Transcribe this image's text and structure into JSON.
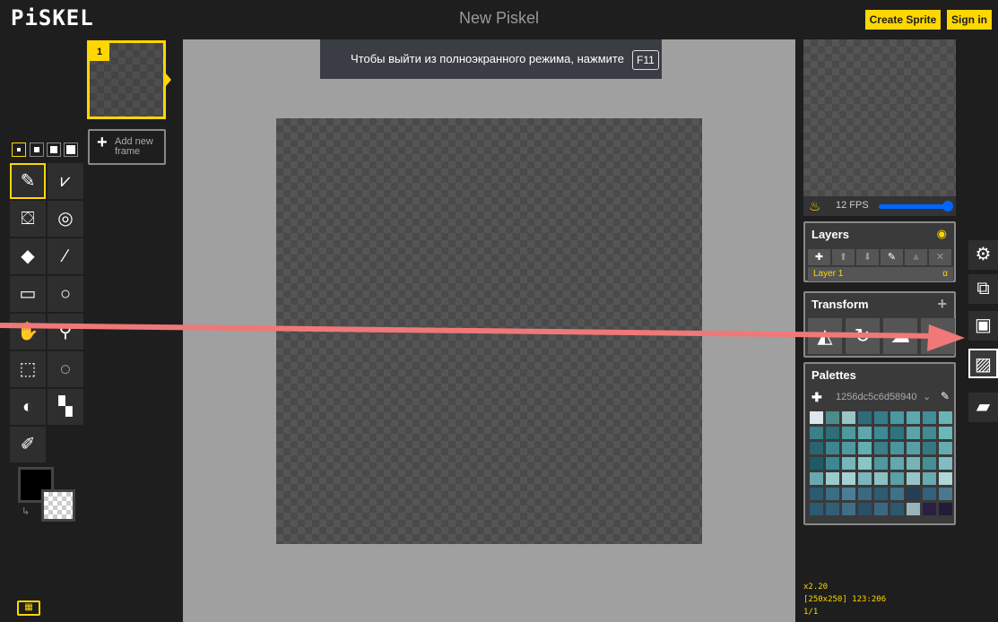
{
  "app": {
    "logo": "PiSKEL",
    "title": "New Piskel"
  },
  "header": {
    "create_sprite": "Create Sprite",
    "sign_in": "Sign in"
  },
  "frames": {
    "first_number": "1",
    "add_frame": "Add new frame"
  },
  "tools": {
    "items": [
      "pen-tool",
      "vertical-mirror-pen-tool",
      "paint-bucket-tool",
      "paint-same-color-tool",
      "eraser-tool",
      "stroke-tool",
      "rectangle-tool",
      "circle-tool",
      "move-tool",
      "shape-selection-tool",
      "rectangle-selection-tool",
      "lasso-selection-tool",
      "lighten-tool",
      "dithering-tool",
      "color-picker-tool"
    ],
    "selected": "pen-tool"
  },
  "colors": {
    "primary": "#000000",
    "secondary": "transparent"
  },
  "fullscreen_banner": {
    "text": "Чтобы выйти из полноэкранного режима, нажмите",
    "key": "F11"
  },
  "preview": {
    "fps": "12 FPS",
    "fps_fraction": 1.0
  },
  "layers": {
    "title": "Layers",
    "layer_name": "Layer 1",
    "alpha": "α"
  },
  "transform": {
    "title": "Transform"
  },
  "palettes": {
    "title": "Palettes",
    "selected": "1256dc5c6d58940",
    "swatches": [
      "#dce8ee",
      "#4e8b8b",
      "#9bc4c4",
      "#2f6b7a",
      "#357d8a",
      "#4a98a4",
      "#5aa9b0",
      "#3f8e9a",
      "#6ab4b8",
      "#3a8088",
      "#2e6e78",
      "#4b9aa0",
      "#5fa8ae",
      "#3c8a96",
      "#2d747e",
      "#5aa4aa",
      "#418c94",
      "#6ab8ba",
      "#2a6470",
      "#3d8590",
      "#5199a0",
      "#62aeb2",
      "#3a7e88",
      "#4a96a0",
      "#579fa6",
      "#347884",
      "#63acb0",
      "#1e5a66",
      "#3b8894",
      "#74b6ba",
      "#8ac4c6",
      "#4e98a0",
      "#62a8ae",
      "#76b4b8",
      "#468e96",
      "#80bcc0",
      "#6aa8b0",
      "#9ccacc",
      "#a8d0d2",
      "#7ab6ba",
      "#8cc0c4",
      "#5aa0a6",
      "#94c6c8",
      "#68aab0",
      "#b0d6d8",
      "#2c5a70",
      "#3a6e86",
      "#4a7e96",
      "#3a6a80",
      "#2e5c72",
      "#3e7288",
      "#243e56",
      "#33607a",
      "#4a7890",
      "#2c5a72",
      "#325f78",
      "#3e6e88",
      "#2a5068",
      "#3a6884",
      "#2e5870",
      "#9ab4bc",
      "#2a1e44",
      "#241a3a"
    ]
  },
  "info": {
    "zoom": "x2.20",
    "cursor": "[250x250] 123:206",
    "frame": "1/1"
  },
  "side_panel": {
    "items": [
      "settings-icon",
      "resize-icon",
      "save-icon",
      "export-image-icon",
      "open-folder-icon"
    ]
  },
  "accent": "#ffd700",
  "annotation_arrow_color": "#f07878"
}
